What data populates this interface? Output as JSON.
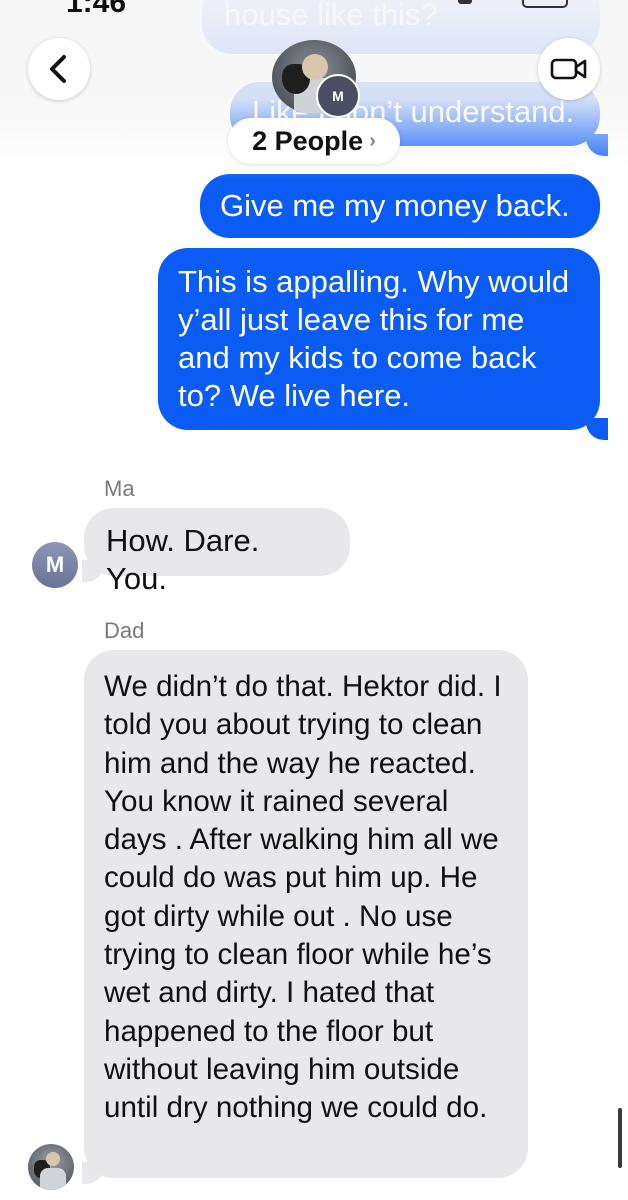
{
  "status_bar": {
    "time": "1:46"
  },
  "header": {
    "people_label": "2 People",
    "chevron": "›",
    "avatar_initial": "M",
    "back_icon": "chevron-left-icon",
    "video_icon": "video-camera-icon"
  },
  "colors": {
    "sent_bubble": "#0a5cf5",
    "received_bubble": "#e8e8eb"
  },
  "messages": [
    {
      "from": "me",
      "text": "house like this?"
    },
    {
      "from": "me",
      "text": "Like I don’t understand."
    },
    {
      "from": "me",
      "text": "Give me my money back."
    },
    {
      "from": "me",
      "text": "This is appalling. Why would y’all just leave this for me and my kids to come back to? We live here."
    },
    {
      "from": "Ma",
      "sender_label": "Ma",
      "avatar_initial": "M",
      "text": "How. Dare. You."
    },
    {
      "from": "Dad",
      "sender_label": "Dad",
      "text": "We didn’t do that. Hektor did. I told you about trying to clean him and the way he reacted. You know it rained several days . After walking him all we could do was put him up. He got dirty while out . No use trying to clean floor while he’s wet and dirty. I hated that happened to the floor but without leaving him outside until dry nothing we could do."
    }
  ]
}
